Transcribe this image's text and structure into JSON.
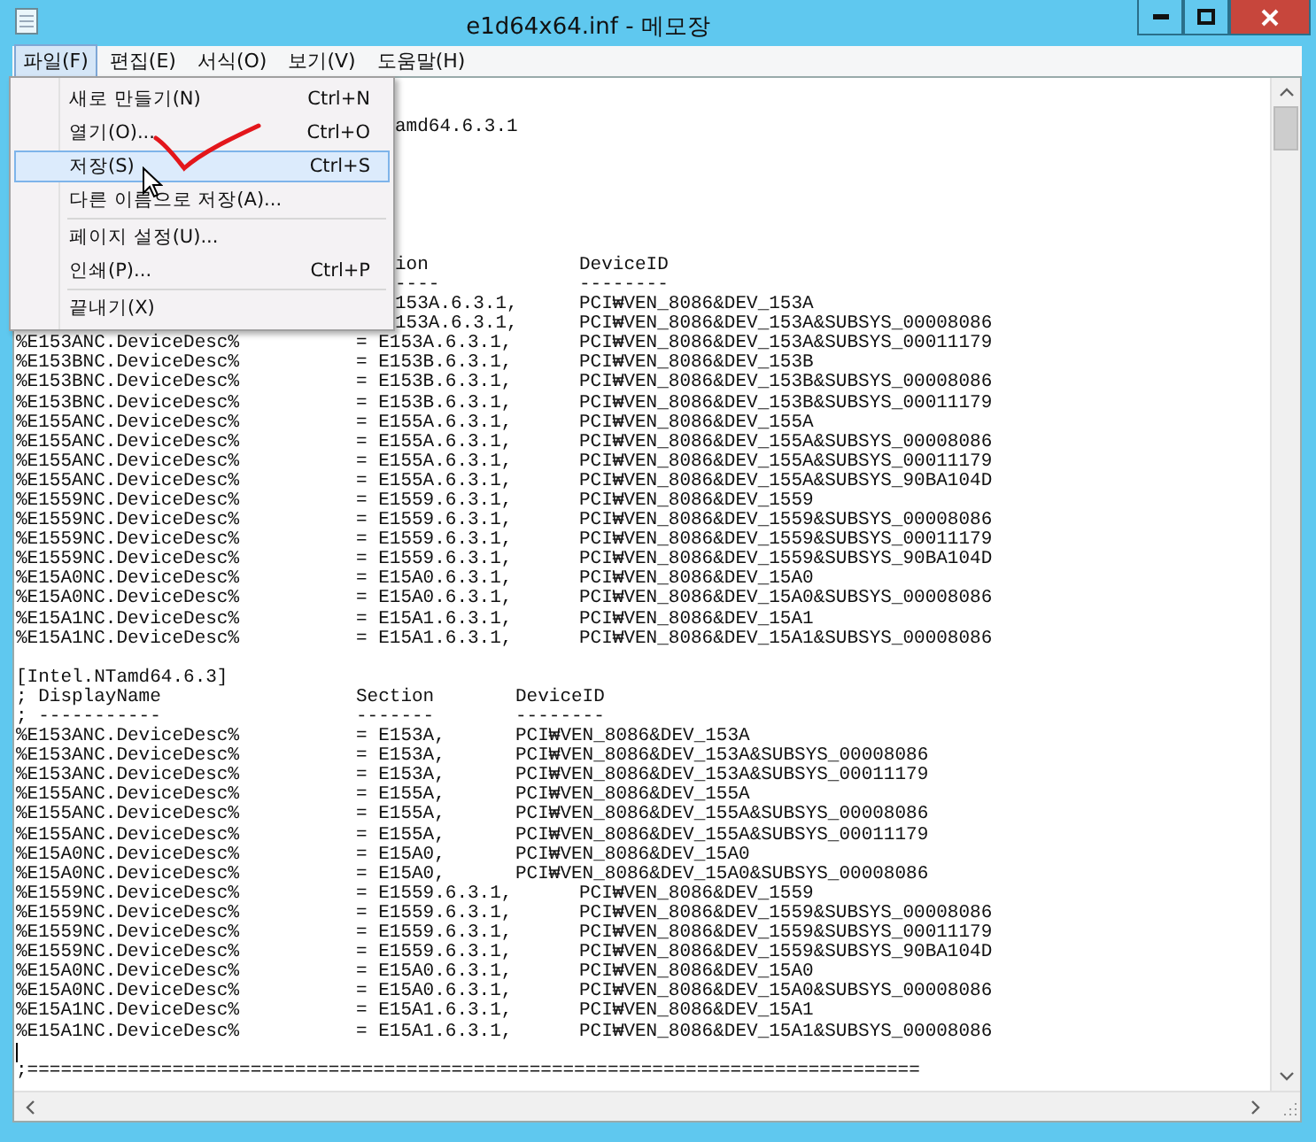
{
  "window": {
    "title": "e1d64x64.inf - 메모장"
  },
  "menu_bar": [
    {
      "label": "파일(F)",
      "selected": true
    },
    {
      "label": "편집(E)",
      "selected": false
    },
    {
      "label": "서식(O)",
      "selected": false
    },
    {
      "label": "보기(V)",
      "selected": false
    },
    {
      "label": "도움말(H)",
      "selected": false
    }
  ],
  "file_menu": [
    {
      "kind": "item",
      "label": "새로 만들기(N)",
      "shortcut": "Ctrl+N",
      "selected": false
    },
    {
      "kind": "item",
      "label": "열기(O)...",
      "shortcut": "Ctrl+O",
      "selected": false
    },
    {
      "kind": "item",
      "label": "저장(S)",
      "shortcut": "Ctrl+S",
      "selected": true
    },
    {
      "kind": "item",
      "label": "다른 이름으로 저장(A)...",
      "selected": false
    },
    {
      "kind": "separator"
    },
    {
      "kind": "item",
      "label": "페이지 설정(U)...",
      "selected": false
    },
    {
      "kind": "item",
      "label": "인쇄(P)...",
      "shortcut": "Ctrl+P",
      "selected": false
    },
    {
      "kind": "separator"
    },
    {
      "kind": "item",
      "label": "끝내기(X)",
      "selected": false
    }
  ],
  "editor": {
    "lines": [
      {
        "kind": "blank"
      },
      {
        "kind": "blank"
      },
      {
        "kind": "clipped",
        "section": "amd64.6.3.1"
      },
      {
        "kind": "blank"
      },
      {
        "kind": "blank"
      },
      {
        "kind": "blank"
      },
      {
        "kind": "blank"
      },
      {
        "kind": "blank"
      },
      {
        "kind": "blank"
      },
      {
        "kind": "clipped",
        "section": "ion",
        "device": "DeviceID"
      },
      {
        "kind": "clipped",
        "section": "----",
        "device": "--------"
      },
      {
        "kind": "clipped",
        "section": "153A.6.3.1,",
        "device": "PCI₩VEN_8086&DEV_153A"
      },
      {
        "kind": "clipped",
        "section": "153A.6.3.1,",
        "device": "PCI₩VEN_8086&DEV_153A&SUBSYS_00008086"
      },
      {
        "kind": "long",
        "name": "%E153ANC.DeviceDesc%",
        "section": "= E153A.6.3.1,",
        "device": "PCI₩VEN_8086&DEV_153A&SUBSYS_00011179"
      },
      {
        "kind": "long",
        "name": "%E153BNC.DeviceDesc%",
        "section": "= E153B.6.3.1,",
        "device": "PCI₩VEN_8086&DEV_153B"
      },
      {
        "kind": "long",
        "name": "%E153BNC.DeviceDesc%",
        "section": "= E153B.6.3.1,",
        "device": "PCI₩VEN_8086&DEV_153B&SUBSYS_00008086"
      },
      {
        "kind": "long",
        "name": "%E153BNC.DeviceDesc%",
        "section": "= E153B.6.3.1,",
        "device": "PCI₩VEN_8086&DEV_153B&SUBSYS_00011179"
      },
      {
        "kind": "long",
        "name": "%E155ANC.DeviceDesc%",
        "section": "= E155A.6.3.1,",
        "device": "PCI₩VEN_8086&DEV_155A"
      },
      {
        "kind": "long",
        "name": "%E155ANC.DeviceDesc%",
        "section": "= E155A.6.3.1,",
        "device": "PCI₩VEN_8086&DEV_155A&SUBSYS_00008086"
      },
      {
        "kind": "long",
        "name": "%E155ANC.DeviceDesc%",
        "section": "= E155A.6.3.1,",
        "device": "PCI₩VEN_8086&DEV_155A&SUBSYS_00011179"
      },
      {
        "kind": "long",
        "name": "%E155ANC.DeviceDesc%",
        "section": "= E155A.6.3.1,",
        "device": "PCI₩VEN_8086&DEV_155A&SUBSYS_90BA104D"
      },
      {
        "kind": "long",
        "name": "%E1559NC.DeviceDesc%",
        "section": "= E1559.6.3.1,",
        "device": "PCI₩VEN_8086&DEV_1559"
      },
      {
        "kind": "long",
        "name": "%E1559NC.DeviceDesc%",
        "section": "= E1559.6.3.1,",
        "device": "PCI₩VEN_8086&DEV_1559&SUBSYS_00008086"
      },
      {
        "kind": "long",
        "name": "%E1559NC.DeviceDesc%",
        "section": "= E1559.6.3.1,",
        "device": "PCI₩VEN_8086&DEV_1559&SUBSYS_00011179"
      },
      {
        "kind": "long",
        "name": "%E1559NC.DeviceDesc%",
        "section": "= E1559.6.3.1,",
        "device": "PCI₩VEN_8086&DEV_1559&SUBSYS_90BA104D"
      },
      {
        "kind": "long",
        "name": "%E15A0NC.DeviceDesc%",
        "section": "= E15A0.6.3.1,",
        "device": "PCI₩VEN_8086&DEV_15A0"
      },
      {
        "kind": "long",
        "name": "%E15A0NC.DeviceDesc%",
        "section": "= E15A0.6.3.1,",
        "device": "PCI₩VEN_8086&DEV_15A0&SUBSYS_00008086"
      },
      {
        "kind": "long",
        "name": "%E15A1NC.DeviceDesc%",
        "section": "= E15A1.6.3.1,",
        "device": "PCI₩VEN_8086&DEV_15A1"
      },
      {
        "kind": "long",
        "name": "%E15A1NC.DeviceDesc%",
        "section": "= E15A1.6.3.1,",
        "device": "PCI₩VEN_8086&DEV_15A1&SUBSYS_00008086"
      },
      {
        "kind": "blank"
      },
      {
        "kind": "line",
        "text": "[Intel.NTamd64.6.3]"
      },
      {
        "kind": "short",
        "name": "; DisplayName",
        "section": "Section",
        "device": "DeviceID"
      },
      {
        "kind": "short",
        "name": "; -----------",
        "section": "-------",
        "device": "--------"
      },
      {
        "kind": "short",
        "name": "%E153ANC.DeviceDesc%",
        "section": "= E153A,",
        "device": "PCI₩VEN_8086&DEV_153A"
      },
      {
        "kind": "short",
        "name": "%E153ANC.DeviceDesc%",
        "section": "= E153A,",
        "device": "PCI₩VEN_8086&DEV_153A&SUBSYS_00008086"
      },
      {
        "kind": "short",
        "name": "%E153ANC.DeviceDesc%",
        "section": "= E153A,",
        "device": "PCI₩VEN_8086&DEV_153A&SUBSYS_00011179"
      },
      {
        "kind": "short",
        "name": "%E155ANC.DeviceDesc%",
        "section": "= E155A,",
        "device": "PCI₩VEN_8086&DEV_155A"
      },
      {
        "kind": "short",
        "name": "%E155ANC.DeviceDesc%",
        "section": "= E155A,",
        "device": "PCI₩VEN_8086&DEV_155A&SUBSYS_00008086"
      },
      {
        "kind": "short",
        "name": "%E155ANC.DeviceDesc%",
        "section": "= E155A,",
        "device": "PCI₩VEN_8086&DEV_155A&SUBSYS_00011179"
      },
      {
        "kind": "short",
        "name": "%E15A0NC.DeviceDesc%",
        "section": "= E15A0,",
        "device": "PCI₩VEN_8086&DEV_15A0"
      },
      {
        "kind": "short",
        "name": "%E15A0NC.DeviceDesc%",
        "section": "= E15A0,",
        "device": "PCI₩VEN_8086&DEV_15A0&SUBSYS_00008086"
      },
      {
        "kind": "long",
        "name": "%E1559NC.DeviceDesc%",
        "section": "= E1559.6.3.1,",
        "device": "PCI₩VEN_8086&DEV_1559"
      },
      {
        "kind": "long",
        "name": "%E1559NC.DeviceDesc%",
        "section": "= E1559.6.3.1,",
        "device": "PCI₩VEN_8086&DEV_1559&SUBSYS_00008086"
      },
      {
        "kind": "long",
        "name": "%E1559NC.DeviceDesc%",
        "section": "= E1559.6.3.1,",
        "device": "PCI₩VEN_8086&DEV_1559&SUBSYS_00011179"
      },
      {
        "kind": "long",
        "name": "%E1559NC.DeviceDesc%",
        "section": "= E1559.6.3.1,",
        "device": "PCI₩VEN_8086&DEV_1559&SUBSYS_90BA104D"
      },
      {
        "kind": "long",
        "name": "%E15A0NC.DeviceDesc%",
        "section": "= E15A0.6.3.1,",
        "device": "PCI₩VEN_8086&DEV_15A0"
      },
      {
        "kind": "long",
        "name": "%E15A0NC.DeviceDesc%",
        "section": "= E15A0.6.3.1,",
        "device": "PCI₩VEN_8086&DEV_15A0&SUBSYS_00008086"
      },
      {
        "kind": "long",
        "name": "%E15A1NC.DeviceDesc%",
        "section": "= E15A1.6.3.1,",
        "device": "PCI₩VEN_8086&DEV_15A1"
      },
      {
        "kind": "long",
        "name": "%E15A1NC.DeviceDesc%",
        "section": "= E15A1.6.3.1,",
        "device": "PCI₩VEN_8086&DEV_15A1&SUBSYS_00008086"
      },
      {
        "kind": "caret"
      },
      {
        "kind": "line",
        "text": ";================================================================================"
      }
    ]
  }
}
